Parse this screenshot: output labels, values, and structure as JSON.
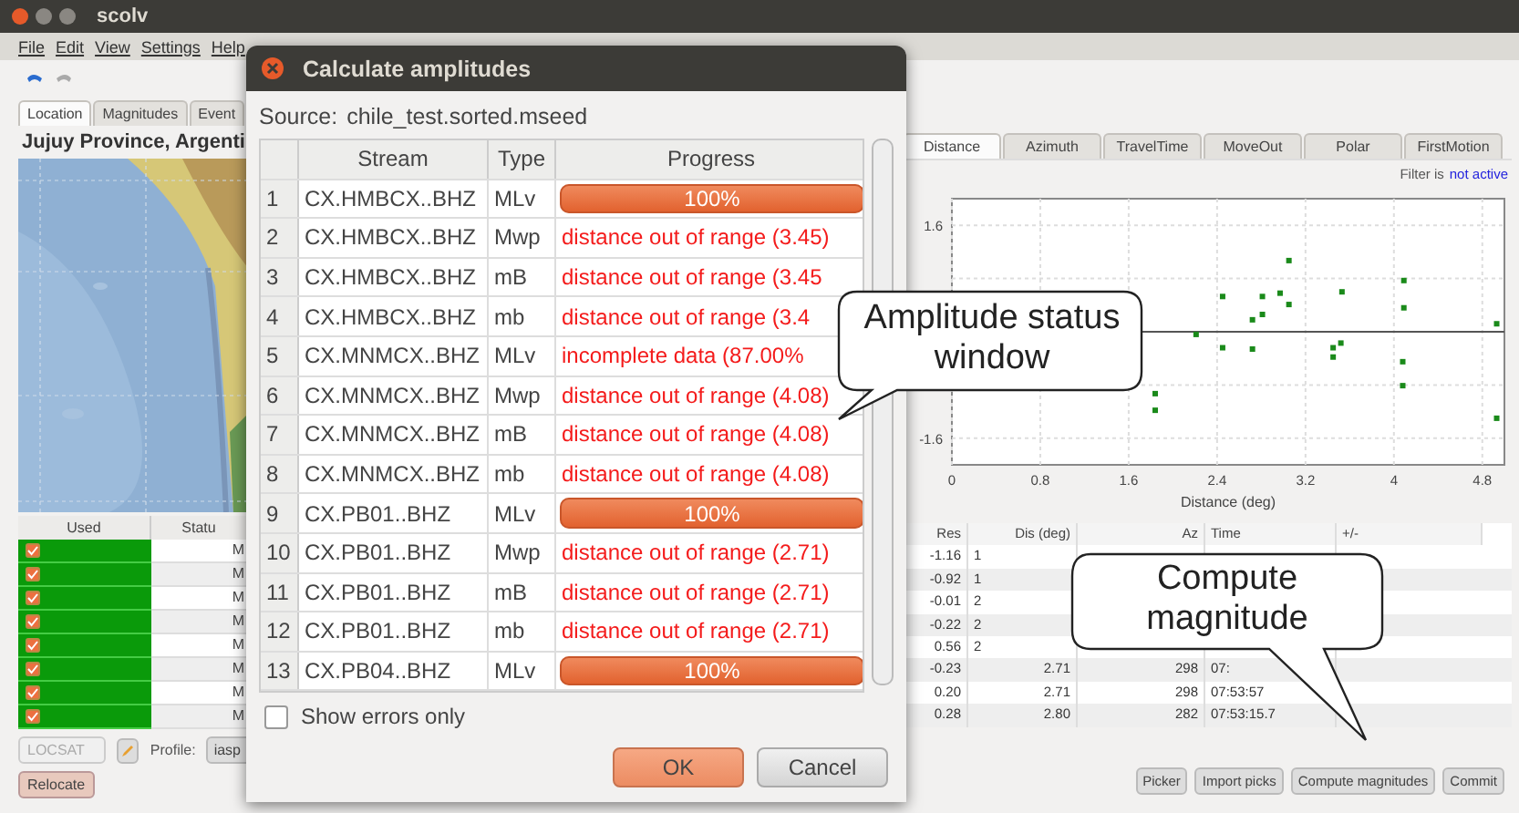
{
  "window": {
    "title": "scolv"
  },
  "menu": [
    "File",
    "Edit",
    "View",
    "Settings",
    "Help"
  ],
  "toolbar": [
    {
      "disabled": false
    },
    {
      "disabled": true
    }
  ],
  "left_panel": {
    "tabs": [
      {
        "label": "Location",
        "selected": true
      },
      {
        "label": "Magnitudes",
        "selected": false
      },
      {
        "label": "Event",
        "selected": false
      }
    ],
    "region": "Jujuy Province, Argenti",
    "table": {
      "columns": [
        "Used",
        "Statu"
      ],
      "rows": [
        {
          "checked": true,
          "status": "M"
        },
        {
          "checked": true,
          "status": "M"
        },
        {
          "checked": true,
          "status": "M"
        },
        {
          "checked": true,
          "status": "M"
        },
        {
          "checked": true,
          "status": "M"
        },
        {
          "checked": true,
          "status": "M"
        },
        {
          "checked": true,
          "status": "M"
        },
        {
          "checked": true,
          "status": "M"
        }
      ]
    },
    "locator": "LOCSAT",
    "profile_label": "Profile:",
    "profile": "iasp",
    "relocate": "Relocate"
  },
  "right_panel": {
    "tabs": [
      {
        "label": "Distance",
        "selected": true
      },
      {
        "label": "Azimuth",
        "selected": false
      },
      {
        "label": "TravelTime",
        "selected": false
      },
      {
        "label": "MoveOut",
        "selected": false
      },
      {
        "label": "Polar",
        "selected": false
      },
      {
        "label": "FirstMotion",
        "selected": false
      }
    ],
    "filter_label": "Filter is",
    "filter_state": "not active",
    "chart_data": {
      "type": "scatter",
      "grid": true,
      "xlabel": "Distance (deg)",
      "xlim": [
        0,
        5
      ],
      "ylim": [
        -2,
        2
      ],
      "xticks": [
        0,
        0.8,
        1.6,
        2.4,
        3.2,
        4,
        4.8
      ],
      "yticks": [
        1.6,
        -1.6
      ],
      "x": [
        3.05,
        2.45,
        2.81,
        2.97,
        3.05,
        2.72,
        2.81,
        3.53,
        4.09,
        4.09,
        4.93,
        2.21,
        2.45,
        2.72,
        3.45,
        3.52,
        3.45,
        4.08,
        4.08,
        1.84,
        1.84,
        4.93
      ],
      "series": [
        {
          "color": "#1a8a1a",
          "values": [
            1.07,
            0.53,
            0.53,
            0.58,
            0.41,
            0.18,
            0.26,
            0.6,
            0.77,
            0.36,
            0.12,
            -0.04,
            -0.24,
            -0.26,
            -0.24,
            -0.17,
            -0.38,
            -0.45,
            -0.81,
            -0.93,
            -1.18,
            -1.3
          ]
        }
      ]
    },
    "table": {
      "columns": [
        "Res",
        "Dis (deg)",
        "Az",
        "Time",
        "+/-"
      ],
      "rows": [
        {
          "res": "-1.16",
          "dis": "1"
        },
        {
          "res": "-0.92",
          "dis": "1"
        },
        {
          "res": "-0.01",
          "dis": "2"
        },
        {
          "res": "-0.22",
          "dis": "2"
        },
        {
          "res": "0.56",
          "dis": "2"
        },
        {
          "res": "-0.23",
          "dis": "2.71",
          "az": "298",
          "time": "07:"
        },
        {
          "res": "0.20",
          "dis": "2.71",
          "az": "298",
          "time": "07:53:57"
        },
        {
          "res": "0.28",
          "dis": "2.80",
          "az": "282",
          "time": "07:53:15.7"
        }
      ]
    },
    "buttons": [
      "Picker",
      "Import picks",
      "Compute magnitudes",
      "Commit"
    ]
  },
  "dialog": {
    "title": "Calculate amplitudes",
    "source_label": "Source:",
    "source": "chile_test.sorted.mseed",
    "columns": [
      "Stream",
      "Type",
      "Progress"
    ],
    "rows": [
      {
        "index": "1",
        "stream": "CX.HMBCX..BHZ",
        "type": "MLv",
        "kind": "progress",
        "level": 1,
        "text": "100%"
      },
      {
        "index": "2",
        "stream": "CX.HMBCX..BHZ",
        "type": "Mwp",
        "kind": "error",
        "text": "distance out of range (3.45)"
      },
      {
        "index": "3",
        "stream": "CX.HMBCX..BHZ",
        "type": "mB",
        "kind": "error",
        "text": "distance out of range (3.45"
      },
      {
        "index": "4",
        "stream": "CX.HMBCX..BHZ",
        "type": "mb",
        "kind": "error",
        "text": "distance out of range (3.4"
      },
      {
        "index": "5",
        "stream": "CX.MNMCX..BHZ",
        "type": "MLv",
        "kind": "error",
        "text": "incomplete data (87.00%"
      },
      {
        "index": "6",
        "stream": "CX.MNMCX..BHZ",
        "type": "Mwp",
        "kind": "error",
        "text": "distance out of range (4.08)"
      },
      {
        "index": "7",
        "stream": "CX.MNMCX..BHZ",
        "type": "mB",
        "kind": "error",
        "text": "distance out of range (4.08)"
      },
      {
        "index": "8",
        "stream": "CX.MNMCX..BHZ",
        "type": "mb",
        "kind": "error",
        "text": "distance out of range (4.08)"
      },
      {
        "index": "9",
        "stream": "CX.PB01..BHZ",
        "type": "MLv",
        "kind": "progress",
        "level": 1,
        "text": "100%"
      },
      {
        "index": "10",
        "stream": "CX.PB01..BHZ",
        "type": "Mwp",
        "kind": "error",
        "text": "distance out of range (2.71)"
      },
      {
        "index": "11",
        "stream": "CX.PB01..BHZ",
        "type": "mB",
        "kind": "error",
        "text": "distance out of range (2.71)"
      },
      {
        "index": "12",
        "stream": "CX.PB01..BHZ",
        "type": "mb",
        "kind": "error",
        "text": "distance out of range (2.71)"
      },
      {
        "index": "13",
        "stream": "CX.PB04..BHZ",
        "type": "MLv",
        "kind": "progress",
        "level": 1,
        "text": "100%"
      }
    ],
    "show_errors": {
      "label": "Show errors only",
      "checked": false
    },
    "buttons": [
      "OK",
      "Cancel"
    ]
  },
  "callouts": [
    {
      "text": "Amplitude status window"
    },
    {
      "text": "Compute magnitude"
    }
  ]
}
